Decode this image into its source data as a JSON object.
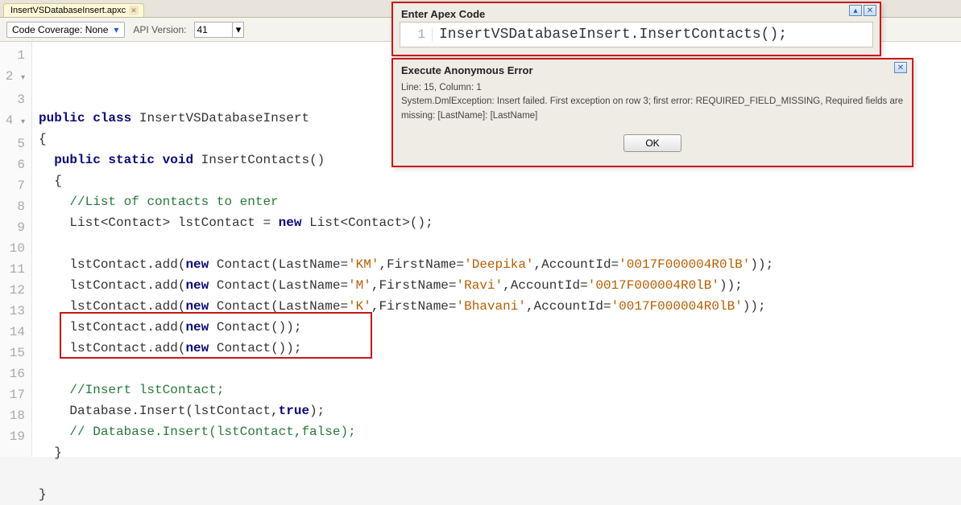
{
  "tab": {
    "filename": "InsertVSDatabaseInsert.apxc"
  },
  "toolbar": {
    "coverage_label": "Code Coverage: None",
    "api_label": "API Version:",
    "api_value": "41"
  },
  "editor": {
    "lines": [
      {
        "n": 1,
        "html": "<span class='kw'>public</span> <span class='kw'>class</span> InsertVSDatabaseInsert"
      },
      {
        "n": 2,
        "fold": true,
        "html": "{"
      },
      {
        "n": 3,
        "html": "  <span class='kw'>public</span> <span class='kw'>static</span> <span class='kw'>void</span> InsertContacts()"
      },
      {
        "n": 4,
        "fold": true,
        "html": "  {"
      },
      {
        "n": 5,
        "html": "    <span class='cm'>//List of contacts to enter</span>"
      },
      {
        "n": 6,
        "html": "    List&lt;Contact&gt; lstContact = <span class='kw'>new</span> List&lt;Contact&gt;();"
      },
      {
        "n": 7,
        "html": ""
      },
      {
        "n": 8,
        "html": "    lstContact.add(<span class='kw'>new</span> Contact(LastName=<span class='str'>'KM'</span>,FirstName=<span class='str'>'Deepika'</span>,AccountId=<span class='str'>'0017F000004R0lB'</span>));"
      },
      {
        "n": 9,
        "html": "    lstContact.add(<span class='kw'>new</span> Contact(LastName=<span class='str'>'M'</span>,FirstName=<span class='str'>'Ravi'</span>,AccountId=<span class='str'>'0017F000004R0lB'</span>));"
      },
      {
        "n": 10,
        "html": "    lstContact.add(<span class='kw'>new</span> Contact(LastName=<span class='str'>'K'</span>,FirstName=<span class='str'>'Bhavani'</span>,AccountId=<span class='str'>'0017F000004R0lB'</span>));"
      },
      {
        "n": 11,
        "html": "    lstContact.add(<span class='kw'>new</span> Contact());"
      },
      {
        "n": 12,
        "html": "    lstContact.add(<span class='kw'>new</span> Contact());"
      },
      {
        "n": 13,
        "html": ""
      },
      {
        "n": 14,
        "html": "    <span class='cm'>//Insert lstContact;</span>"
      },
      {
        "n": 15,
        "html": "    Database.Insert(lstContact,<span class='kw'>true</span>);"
      },
      {
        "n": 16,
        "html": "    <span class='cm'>// Database.Insert(lstContact,false);</span>"
      },
      {
        "n": 17,
        "html": "  }"
      },
      {
        "n": 18,
        "html": ""
      },
      {
        "n": 19,
        "html": "}"
      }
    ]
  },
  "apex_panel": {
    "title": "Enter Apex Code",
    "line_no": "1",
    "code": "InsertVSDatabaseInsert.InsertContacts();"
  },
  "error_panel": {
    "title": "Execute Anonymous Error",
    "line1": "Line: 15, Column: 1",
    "line2": "System.DmlException: Insert failed. First exception on row 3; first error: REQUIRED_FIELD_MISSING, Required fields are missing: [LastName]: [LastName]",
    "ok_label": "OK"
  }
}
